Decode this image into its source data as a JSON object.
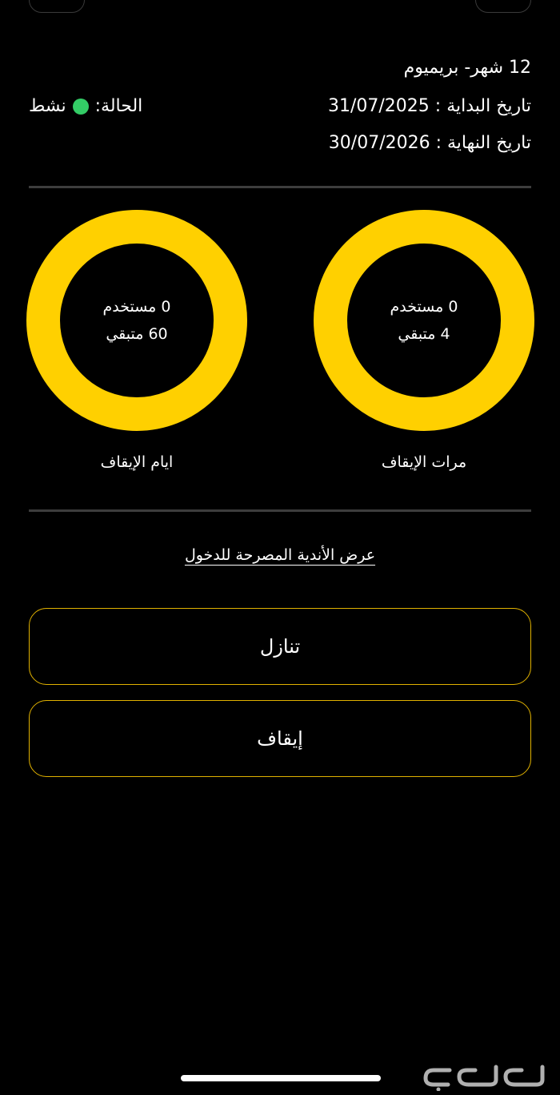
{
  "subscription": {
    "plan": "12 شهر- بريميوم",
    "start_date_line": "تاريخ البداية : 31/07/2025",
    "end_date_line": "تاريخ النهاية : 30/07/2026",
    "status_label": "الحالة:",
    "status_value": "نشط",
    "status_color": "#33cc66"
  },
  "freeze_counts": {
    "used": "0 مستخدم",
    "remaining": "4 متبقي",
    "label": "مرات الإيقاف",
    "used_value": 0,
    "remaining_value": 4
  },
  "freeze_days": {
    "used": "0 مستخدم",
    "remaining": "60 متبقي",
    "label": "ايام الإيقاف",
    "used_value": 0,
    "remaining_value": 60
  },
  "links": {
    "allowed_clubs": "عرض الأندية المصرحة للدخول"
  },
  "actions": {
    "transfer": "تنازل",
    "freeze": "إيقاف"
  },
  "theme": {
    "accent": "#ffd000",
    "background": "#000000"
  },
  "watermark": {
    "brand": "حراج"
  }
}
